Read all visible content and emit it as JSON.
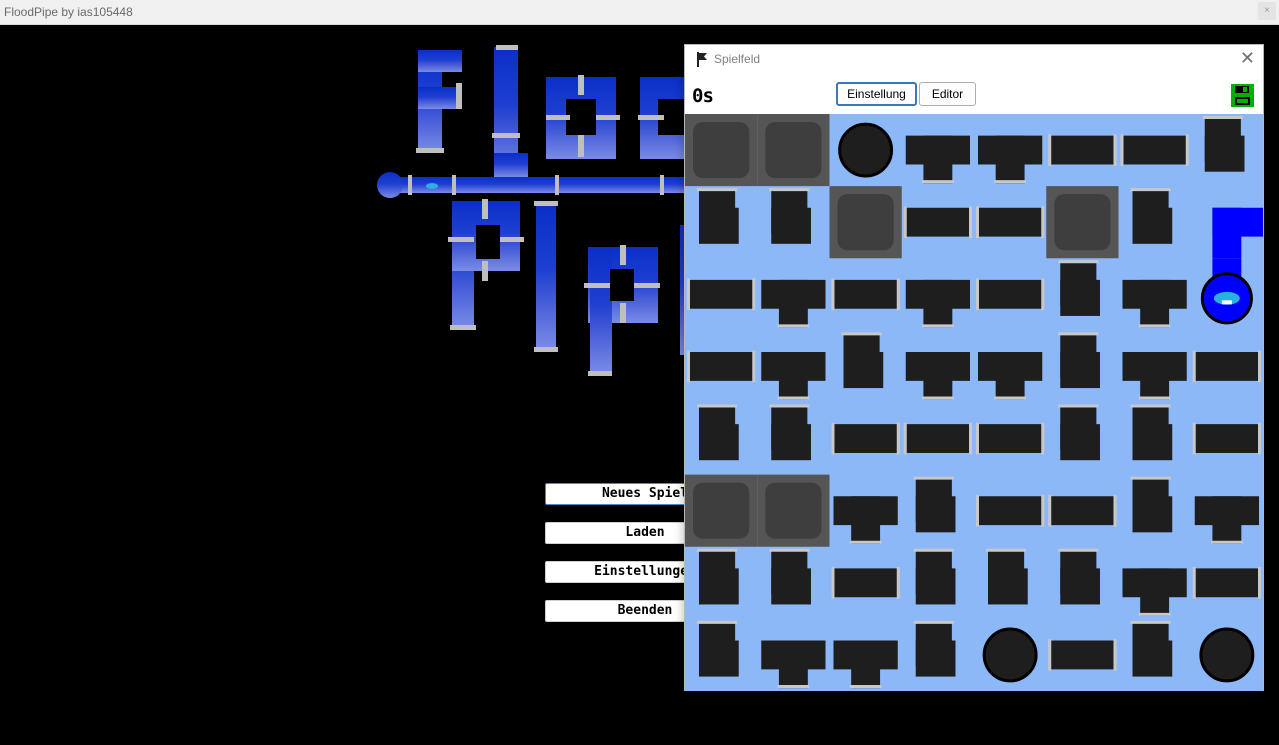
{
  "window": {
    "title": "FloodPipe by ias105448",
    "close_glyph": "×"
  },
  "menu": {
    "new_game": "Neues Spiel",
    "load": "Laden",
    "settings": "Einstellungen",
    "quit": "Beenden"
  },
  "dialog": {
    "title": "Spielfeld",
    "close_glyph": "✕",
    "timer": "0s",
    "tab_settings": "Einstellung",
    "tab_editor": "Editor",
    "save_icon": "floppy-disk-icon"
  },
  "colors": {
    "board_background": "#8cb8f8",
    "pipe": "#1e1e1e",
    "wall": "#3e3e3e",
    "water": "#0000ff",
    "save_icon": "#00b000",
    "logo_blue_top": "#0a2fc8",
    "logo_blue_bottom": "#7a8ce6"
  },
  "board": {
    "rows": 8,
    "cols": 8,
    "cells": [
      [
        "wall",
        "wall",
        "pipe-end",
        "pipe-t",
        "pipe-t",
        "pipe-straight",
        "pipe-straight",
        "pipe-corner"
      ],
      [
        "pipe-corner",
        "pipe-corner",
        "wall",
        "pipe-straight",
        "pipe-straight",
        "wall",
        "pipe-corner",
        "water-corner"
      ],
      [
        "pipe-straight",
        "pipe-t",
        "pipe-straight",
        "pipe-t",
        "pipe-straight",
        "pipe-corner",
        "pipe-t",
        "water-source"
      ],
      [
        "pipe-straight",
        "pipe-t",
        "pipe-corner",
        "pipe-t",
        "pipe-t",
        "pipe-corner",
        "pipe-t",
        "pipe-straight"
      ],
      [
        "pipe-corner",
        "pipe-corner",
        "pipe-straight",
        "pipe-straight",
        "pipe-straight",
        "pipe-corner",
        "pipe-corner",
        "pipe-straight"
      ],
      [
        "wall",
        "wall",
        "pipe-t",
        "pipe-corner",
        "pipe-straight",
        "pipe-straight",
        "pipe-corner",
        "pipe-t"
      ],
      [
        "pipe-corner",
        "pipe-corner",
        "pipe-straight",
        "pipe-corner",
        "pipe-corner",
        "pipe-corner",
        "pipe-t",
        "pipe-straight"
      ],
      [
        "pipe-corner",
        "pipe-t",
        "pipe-t",
        "pipe-corner",
        "pipe-end",
        "pipe-straight",
        "pipe-corner",
        "pipe-end"
      ]
    ]
  }
}
